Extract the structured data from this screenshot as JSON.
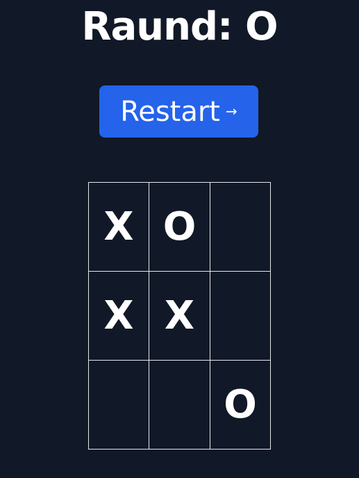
{
  "title": "Raund: O",
  "restart": {
    "label": "Restart",
    "arrow_icon": "→"
  },
  "board": {
    "cells": [
      "X",
      "O",
      "",
      "X",
      "X",
      "",
      "",
      "",
      "O"
    ]
  },
  "colors": {
    "background": "#111827",
    "button": "#2563eb",
    "grid_line": "#e5e7eb",
    "text": "#ffffff"
  }
}
